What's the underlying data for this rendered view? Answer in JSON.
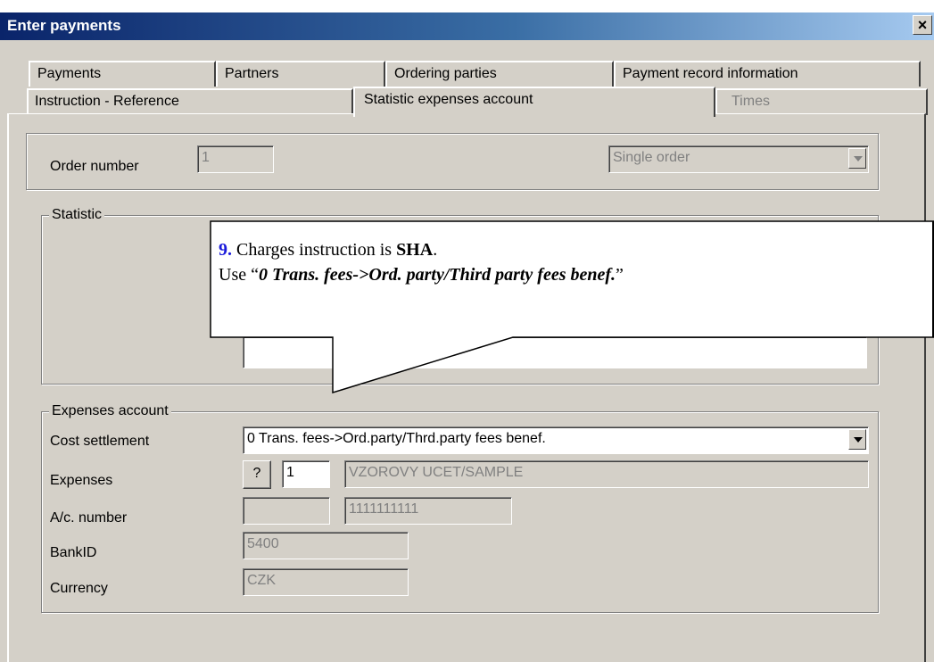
{
  "window": {
    "title": "Enter payments",
    "close_symbol": "×"
  },
  "tabs_row1": [
    {
      "label": "Payments"
    },
    {
      "label": "Partners"
    },
    {
      "label": "Ordering parties"
    },
    {
      "label": "Payment record information"
    }
  ],
  "tabs_row2": [
    {
      "label": "Instruction - Reference"
    },
    {
      "label": "Statistic expenses account",
      "active": true
    },
    {
      "label": "Times",
      "disabled": true
    }
  ],
  "order": {
    "label": "Order number",
    "value": "1",
    "type_value": "Single order"
  },
  "statistic": {
    "legend": "Statistic"
  },
  "expenses_account": {
    "legend": "Expenses account",
    "cost_settlement_label": "Cost settlement",
    "cost_settlement_value": "0 Trans. fees->Ord.party/Thrd.party fees benef.",
    "expenses_label": "Expenses",
    "expenses_button": "?",
    "expenses_code": "1",
    "expenses_name": "VZOROVY UCET/SAMPLE",
    "account_label": "A/c. number",
    "account_prefix": "",
    "account_number": "1111111111",
    "bankid_label": "BankID",
    "bankid_value": "5400",
    "currency_label": "Currency",
    "currency_value": "CZK"
  },
  "callout": {
    "number": "9.",
    "line1_pre": " Charges instruction is ",
    "line1_bold": "SHA",
    "line1_post": ".",
    "line2_pre": "Use  “",
    "line2_bold_italic": "0 Trans. fees->Ord. party/Third party fees benef.",
    "line2_post": "”"
  }
}
